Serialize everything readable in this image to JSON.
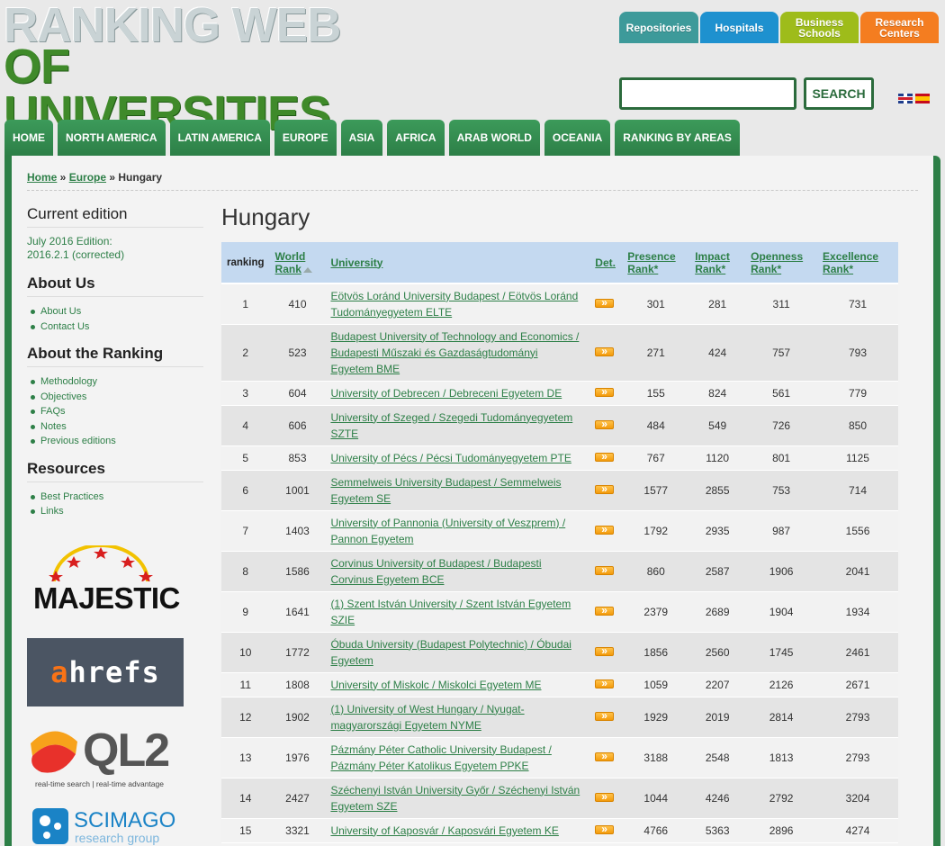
{
  "logo": {
    "line1": "RANKING WEB",
    "line2": "OF UNIVERSITIES"
  },
  "rank_buttons": [
    {
      "label": "Repositories"
    },
    {
      "label": "Hospitals"
    },
    {
      "label": "Business Schools"
    },
    {
      "label": "Research Centers"
    }
  ],
  "search": {
    "value": "",
    "button_label": "SEARCH"
  },
  "nav": [
    "HOME",
    "NORTH AMERICA",
    "LATIN AMERICA",
    "EUROPE",
    "ASIA",
    "AFRICA",
    "ARAB WORLD",
    "OCEANIA",
    "RANKING BY AREAS"
  ],
  "breadcrumb": {
    "home": "Home",
    "sep1": " » ",
    "europe": "Europe",
    "sep2": " » ",
    "current": "Hungary"
  },
  "sidebar": {
    "current_edition_title": "Current edition",
    "edition_line1": "July 2016 Edition:",
    "edition_line2": "2016.2.1 (corrected)",
    "about_us_title": "About Us",
    "about_us_links": [
      "About Us",
      "Contact Us"
    ],
    "about_ranking_title": "About the Ranking",
    "about_ranking_links": [
      "Methodology",
      "Objectives",
      "FAQs",
      "Notes",
      "Previous editions"
    ],
    "resources_title": "Resources",
    "resources_links": [
      "Best Practices",
      "Links"
    ]
  },
  "sponsors": {
    "majestic": "MAJESTIC",
    "ahrefs_a": "a",
    "ahrefs_rest": "hrefs",
    "ql2": "QL2",
    "ql2_tag": "real-time search | real-time advantage",
    "scimago": "SCIMAGO",
    "scimago_sub": "research group"
  },
  "page_title": "Hungary",
  "table": {
    "headers": {
      "ranking": "ranking",
      "world_rank_1": "World",
      "world_rank_2": "Rank",
      "university": "University",
      "det": "Det.",
      "presence_1": "Presence",
      "presence_2": "Rank*",
      "impact_1": "Impact",
      "impact_2": "Rank*",
      "openness_1": "Openness",
      "openness_2": "Rank*",
      "excellence_1": "Excellence",
      "excellence_2": "Rank*"
    },
    "rows": [
      {
        "ranking": "1",
        "world": "410",
        "l1": "Eötvös Loránd University Budapest / Eötvös Loránd",
        "l2": "Tudományegyetem ELTE",
        "l3": "",
        "presence": "301",
        "impact": "281",
        "openness": "311",
        "excellence": "731"
      },
      {
        "ranking": "2",
        "world": "523",
        "l1": "Budapest University of Technology and Economics /",
        "l2": "Budapesti Műszaki és Gazdaságtudományi",
        "l3": "Egyetem BME",
        "presence": "271",
        "impact": "424",
        "openness": "757",
        "excellence": "793"
      },
      {
        "ranking": "3",
        "world": "604",
        "l1": "University of Debrecen / Debreceni Egyetem DE",
        "l2": "",
        "l3": "",
        "presence": "155",
        "impact": "824",
        "openness": "561",
        "excellence": "779"
      },
      {
        "ranking": "4",
        "world": "606",
        "l1": "University of Szeged / Szegedi Tudományegyetem",
        "l2": "SZTE",
        "l3": "",
        "presence": "484",
        "impact": "549",
        "openness": "726",
        "excellence": "850"
      },
      {
        "ranking": "5",
        "world": "853",
        "l1": "University of Pécs / Pécsi Tudományegyetem PTE",
        "l2": "",
        "l3": "",
        "presence": "767",
        "impact": "1120",
        "openness": "801",
        "excellence": "1125"
      },
      {
        "ranking": "6",
        "world": "1001",
        "l1": "Semmelweis University Budapest / Semmelweis",
        "l2": "Egyetem SE",
        "l3": "",
        "presence": "1577",
        "impact": "2855",
        "openness": "753",
        "excellence": "714"
      },
      {
        "ranking": "7",
        "world": "1403",
        "l1": "University of Pannonia (University of Veszprem) /",
        "l2": "Pannon Egyetem",
        "l3": "",
        "presence": "1792",
        "impact": "2935",
        "openness": "987",
        "excellence": "1556"
      },
      {
        "ranking": "8",
        "world": "1586",
        "l1": "Corvinus University of Budapest / Budapesti",
        "l2": "Corvinus Egyetem BCE",
        "l3": "",
        "presence": "860",
        "impact": "2587",
        "openness": "1906",
        "excellence": "2041"
      },
      {
        "ranking": "9",
        "world": "1641",
        "l1": "(1) Szent István University / Szent István Egyetem",
        "l2": "SZIE",
        "l3": "",
        "presence": "2379",
        "impact": "2689",
        "openness": "1904",
        "excellence": "1934"
      },
      {
        "ranking": "10",
        "world": "1772",
        "l1": "Óbuda University (Budapest Polytechnic) / Óbudai",
        "l2": "Egyetem",
        "l3": "",
        "presence": "1856",
        "impact": "2560",
        "openness": "1745",
        "excellence": "2461"
      },
      {
        "ranking": "11",
        "world": "1808",
        "l1": "University of Miskolc / Miskolci Egyetem ME",
        "l2": "",
        "l3": "",
        "presence": "1059",
        "impact": "2207",
        "openness": "2126",
        "excellence": "2671"
      },
      {
        "ranking": "12",
        "world": "1902",
        "l1": "(1) University of West Hungary / Nyugat-",
        "l2": "magyarországi Egyetem NYME",
        "l3": "",
        "presence": "1929",
        "impact": "2019",
        "openness": "2814",
        "excellence": "2793"
      },
      {
        "ranking": "13",
        "world": "1976",
        "l1": "Pázmány Péter Catholic University Budapest /",
        "l2": "Pázmány Péter Katolikus Egyetem PPKE",
        "l3": "",
        "presence": "3188",
        "impact": "2548",
        "openness": "1813",
        "excellence": "2793"
      },
      {
        "ranking": "14",
        "world": "2427",
        "l1": "Széchenyi István University Győr / Széchenyi István",
        "l2": "Egyetem SZE",
        "l3": "",
        "presence": "1044",
        "impact": "4246",
        "openness": "2792",
        "excellence": "3204"
      },
      {
        "ranking": "15",
        "world": "3321",
        "l1": "University of Kaposvár / Kaposvári Egyetem KE",
        "l2": "",
        "l3": "",
        "presence": "4766",
        "impact": "5363",
        "openness": "2896",
        "excellence": "4274"
      }
    ]
  },
  "colors": {
    "brand_green": "#2d7f47",
    "header_blue": "#c4d9f0",
    "det_orange": "#f39b0b"
  }
}
